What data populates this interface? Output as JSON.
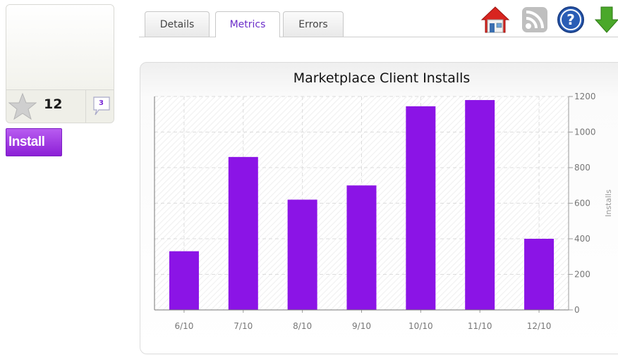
{
  "card": {
    "rating": "12",
    "comment_count": "3"
  },
  "install_label": "Install",
  "tabs": [
    {
      "label": "Details"
    },
    {
      "label": "Metrics"
    },
    {
      "label": "Errors"
    }
  ],
  "active_tab": "Metrics",
  "toolbar_icons": [
    "home-icon",
    "rss-icon",
    "help-icon",
    "download-icon"
  ],
  "colors": {
    "accent": "#8b14e6",
    "tab_active_text": "#6b2dc9"
  },
  "chart_data": {
    "type": "bar",
    "title": "Marketplace Client Installs",
    "xlabel": "",
    "ylabel": "Installs",
    "categories": [
      "6/10",
      "7/10",
      "8/10",
      "9/10",
      "10/10",
      "11/10",
      "12/10"
    ],
    "values": [
      330,
      860,
      620,
      700,
      1145,
      1180,
      400
    ],
    "ylim": [
      0,
      1200
    ],
    "yticks": [
      0,
      200,
      400,
      600,
      800,
      1000,
      1200
    ],
    "y_axis_side": "right",
    "grid": true,
    "bar_color": "#8b14e6",
    "legend": "none"
  }
}
